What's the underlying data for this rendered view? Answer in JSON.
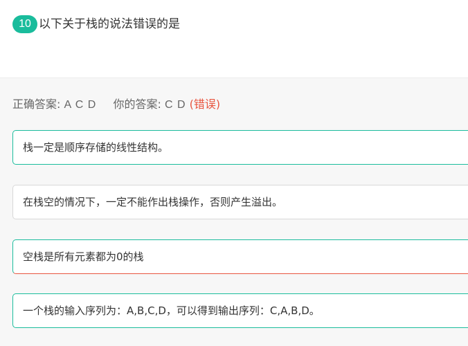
{
  "question": {
    "number": "10",
    "title": "以下关于栈的说法错误的是"
  },
  "answer": {
    "correct_label": "正确答案:",
    "correct_value": "A C D",
    "yours_label": "你的答案:",
    "yours_value": "C D",
    "status": "(错误)"
  },
  "options": [
    {
      "text": "栈一定是顺序存储的线性结构。"
    },
    {
      "text": "在栈空的情况下，一定不能作出栈操作，否则产生溢出。"
    },
    {
      "text": "空栈是所有元素都为0的栈"
    },
    {
      "text": "一个栈的输入序列为：A,B,C,D，可以得到输出序列：C,A,B,D。"
    }
  ],
  "colors": {
    "accent": "#1abc9c",
    "error": "#e8553f"
  }
}
